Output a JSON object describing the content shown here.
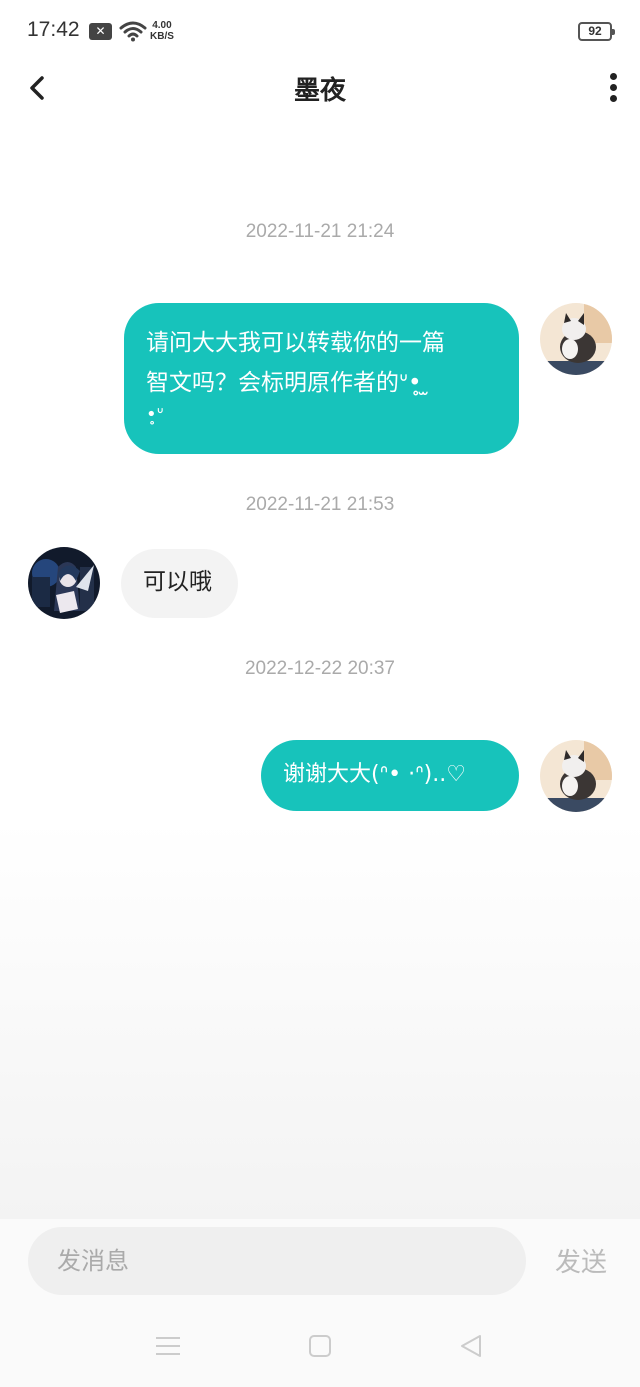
{
  "status_bar": {
    "time": "17:42",
    "notification_icon": "close-box-icon",
    "wifi_icon": "wifi-icon",
    "speed_value": "4.00",
    "speed_unit": "KB/S",
    "battery": "92"
  },
  "header": {
    "title": "墨夜",
    "back_icon": "chevron-left-icon",
    "more_icon": "more-vertical-icon"
  },
  "messages": [
    {
      "timestamp": "2022-11-21 21:24",
      "direction": "outgoing",
      "lines": [
        "请问大大我可以转载你的一篇",
        "智文吗？会标明原作者的ᐡ•̥ ̫ ",
        "•̥ᐡ"
      ]
    },
    {
      "timestamp": "2022-11-21 21:53",
      "direction": "incoming",
      "text": "可以哦"
    },
    {
      "timestamp": "2022-12-22 20:37",
      "direction": "outgoing",
      "text": "谢谢大大(ᐢ• ·ᐢ)..♡"
    }
  ],
  "composer": {
    "placeholder": "发消息",
    "send_label": "发送"
  },
  "system_nav": {
    "menu_icon": "menu-icon",
    "home_icon": "square-home-icon",
    "back_icon": "triangle-back-icon"
  },
  "colors": {
    "outgoing_bubble": "#17c3bb",
    "incoming_bubble": "#f3f3f3",
    "timestamp": "#aaaaaa"
  }
}
